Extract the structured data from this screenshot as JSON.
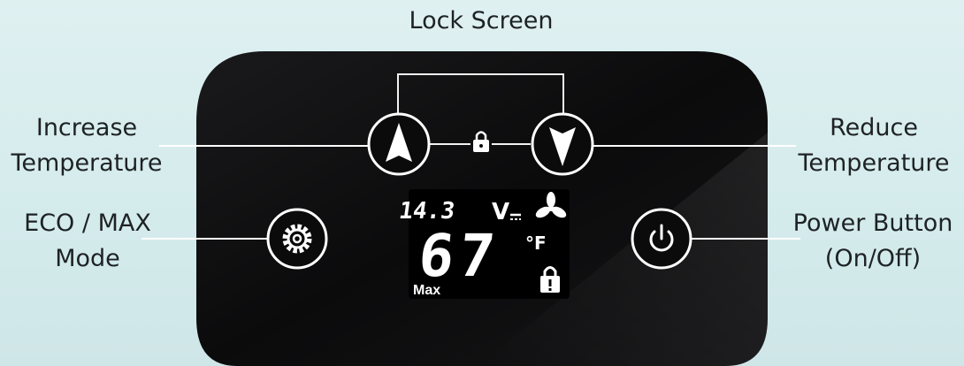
{
  "callouts": {
    "lock_screen": "Lock Screen",
    "increase": [
      "Increase",
      "Temperature"
    ],
    "reduce": [
      "Reduce",
      "Temperature"
    ],
    "eco_max": [
      "ECO / MAX",
      "Mode"
    ],
    "power": [
      "Power Button",
      "(On/Off)"
    ]
  },
  "display": {
    "voltage": "14.3",
    "voltage_unit": "V",
    "temperature": "67",
    "temp_unit": "°F",
    "mode": "Max",
    "lock_indicator": "lock-icon",
    "fan_indicator": "fan-icon",
    "dc_indicator": "dc-power-icon"
  },
  "buttons": {
    "increase": "triangle-up-icon",
    "reduce": "triangle-down-icon",
    "eco_max": "gear-icon",
    "power": "power-icon",
    "lock": "lock-icon"
  },
  "colors": {
    "background": "#d6ecee",
    "panel": "#0b0b0c",
    "button_ring": "#ffffff",
    "display_text": "#ffffff",
    "label_text": "#1e2224"
  }
}
